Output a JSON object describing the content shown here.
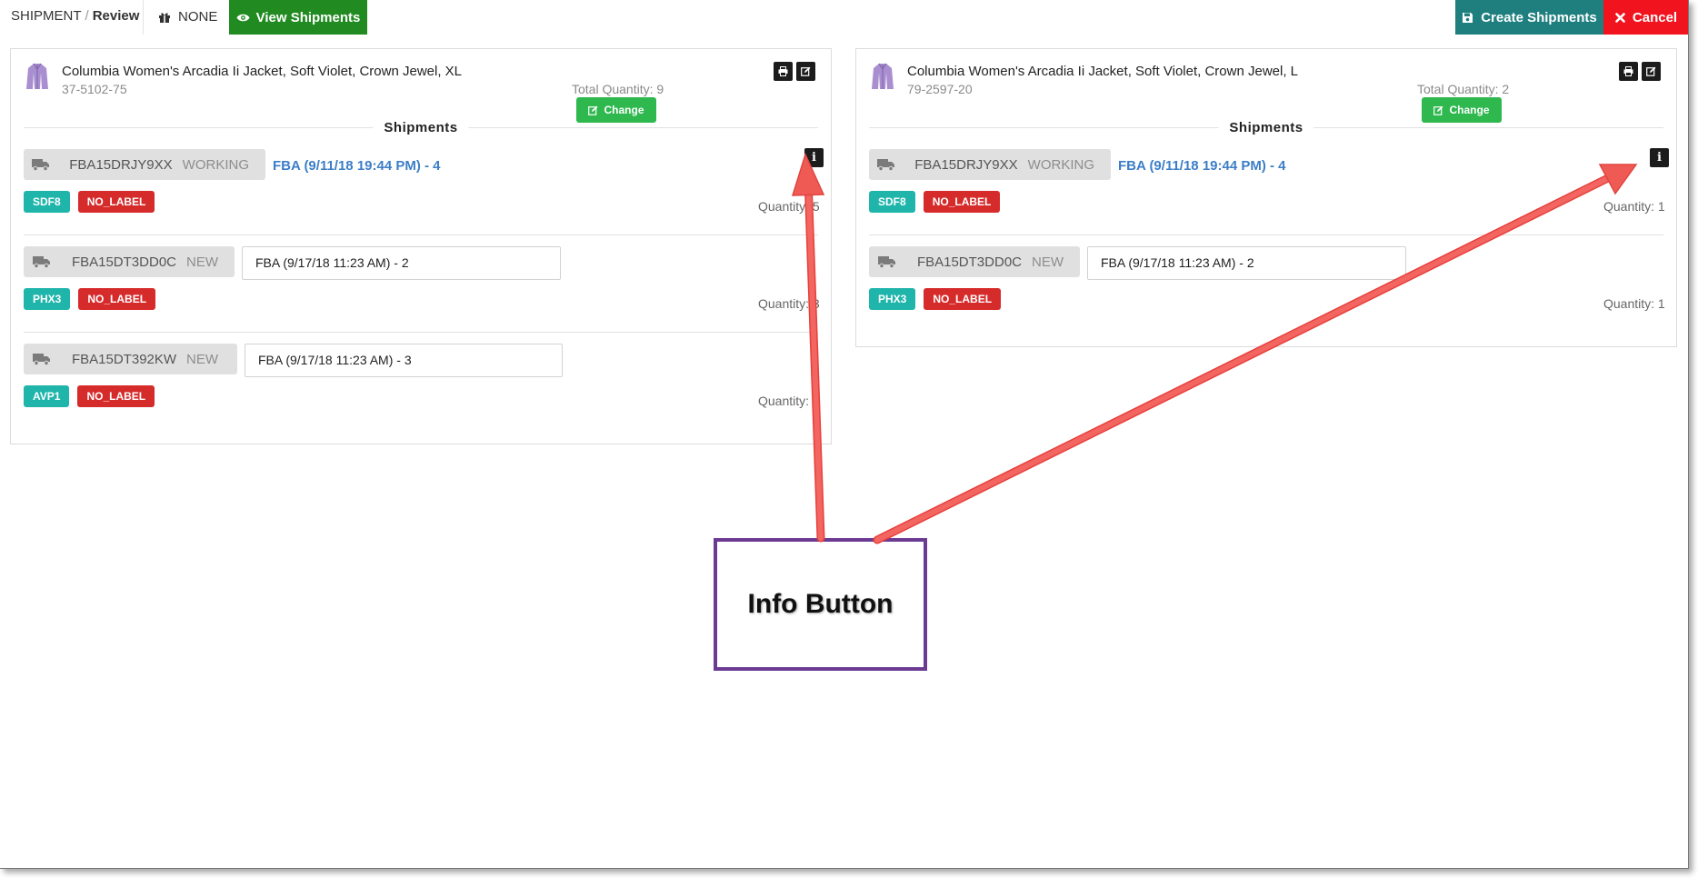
{
  "header": {
    "breadcrumb_section": "SHIPMENT",
    "breadcrumb_separator": "/",
    "breadcrumb_current": "Review",
    "filter_label": "NONE",
    "view_shipments_label": "View Shipments",
    "create_shipments_label": "Create Shipments",
    "cancel_label": "Cancel"
  },
  "colors": {
    "view_green": "#218b21",
    "create_teal": "#1f7f7f",
    "cancel_red": "#f1141f",
    "change_green": "#2eb84e",
    "fc_teal": "#1fb5ab",
    "label_red": "#d62b2b",
    "link_blue": "#3c7ec7",
    "callout_purple": "#6b3b93",
    "arrow_red": "#f0554f"
  },
  "panels": [
    {
      "product_title": "Columbia Women's Arcadia Ii Jacket, Soft Violet, Crown Jewel, XL",
      "sku": "37-5102-75",
      "total_quantity": "Total Quantity: 9",
      "change_label": "Change",
      "shipments_heading": "Shipments",
      "shipments": [
        {
          "id": "FBA15DRJY9XX",
          "status": "WORKING",
          "name": "FBA (9/11/18 19:44 PM) - 4",
          "fc": "SDF8",
          "label": "NO_LABEL",
          "quantity": "Quantity: 5"
        },
        {
          "id": "FBA15DT3DD0C",
          "status": "NEW",
          "name": "FBA (9/17/18 11:23 AM) - 2",
          "fc": "PHX3",
          "label": "NO_LABEL",
          "quantity": "Quantity: 3"
        },
        {
          "id": "FBA15DT392KW",
          "status": "NEW",
          "name": "FBA (9/17/18 11:23 AM) - 3",
          "fc": "AVP1",
          "label": "NO_LABEL",
          "quantity": "Quantity: 1"
        }
      ]
    },
    {
      "product_title": "Columbia Women's Arcadia Ii Jacket, Soft Violet, Crown Jewel, L",
      "sku": "79-2597-20",
      "total_quantity": "Total Quantity: 2",
      "change_label": "Change",
      "shipments_heading": "Shipments",
      "shipments": [
        {
          "id": "FBA15DRJY9XX",
          "status": "WORKING",
          "name": "FBA (9/11/18 19:44 PM) - 4",
          "fc": "SDF8",
          "label": "NO_LABEL",
          "quantity": "Quantity: 1"
        },
        {
          "id": "FBA15DT3DD0C",
          "status": "NEW",
          "name": "FBA (9/17/18 11:23 AM) - 2",
          "fc": "PHX3",
          "label": "NO_LABEL",
          "quantity": "Quantity: 1"
        }
      ]
    }
  ],
  "icons": {
    "filter": "gift-icon",
    "view": "eye-icon",
    "create": "save-icon",
    "cancel": "close-icon",
    "print": "print-icon",
    "edit": "edit-icon",
    "truck": "truck-icon",
    "info": "info-icon",
    "product": "jacket-icon"
  },
  "annotation": {
    "callout_text": "Info Button"
  }
}
